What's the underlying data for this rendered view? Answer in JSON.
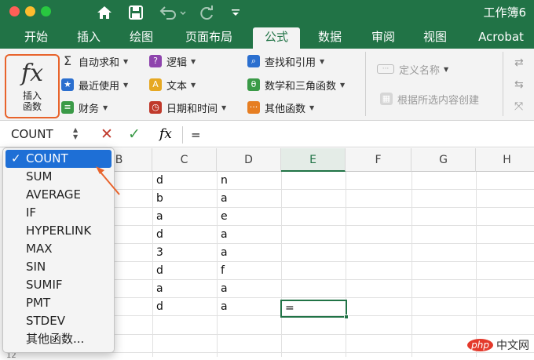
{
  "window": {
    "title": "工作簿6"
  },
  "tabs": [
    {
      "label": "开始"
    },
    {
      "label": "插入"
    },
    {
      "label": "绘图"
    },
    {
      "label": "页面布局"
    },
    {
      "label": "公式"
    },
    {
      "label": "数据"
    },
    {
      "label": "审阅"
    },
    {
      "label": "视图"
    },
    {
      "label": "Acrobat"
    }
  ],
  "ribbon": {
    "insert_function": {
      "glyph": "fx",
      "label_line1": "插入",
      "label_line2": "函数"
    },
    "autosum": "自动求和",
    "recent": "最近使用",
    "financial": "财务",
    "logical": "逻辑",
    "text": "文本",
    "datetime": "日期和时间",
    "lookup": "查找和引用",
    "math": "数学和三角函数",
    "other": "其他函数",
    "define_name": "定义名称",
    "create_from_selection": "根据所选内容创建"
  },
  "formula_bar": {
    "name_box": "COUNT",
    "fx": "fx",
    "value": "="
  },
  "columns": [
    "B",
    "C",
    "D",
    "E",
    "F",
    "G",
    "H"
  ],
  "selected_column": "E",
  "rows": [
    {
      "c": "d",
      "d": "n"
    },
    {
      "c": "b",
      "d": "a"
    },
    {
      "c": "a",
      "d": "e"
    },
    {
      "c": "d",
      "d": "a"
    },
    {
      "c": "3",
      "d": "a"
    },
    {
      "c": "d",
      "d": "f"
    },
    {
      "c": "a",
      "d": "a"
    },
    {
      "c": "d",
      "d": "a"
    }
  ],
  "active_cell_value": "=",
  "dropdown": {
    "items": [
      "COUNT",
      "SUM",
      "AVERAGE",
      "IF",
      "HYPERLINK",
      "MAX",
      "SIN",
      "SUMIF",
      "PMT",
      "STDEV",
      "其他函数..."
    ],
    "selected": "COUNT",
    "check": "✓"
  },
  "row_number_partial": "12",
  "watermark": {
    "badge": "php",
    "text": "中文网"
  },
  "colors": {
    "brand": "#217346",
    "highlight": "#1e6fd6",
    "annotation": "#e8632b"
  }
}
